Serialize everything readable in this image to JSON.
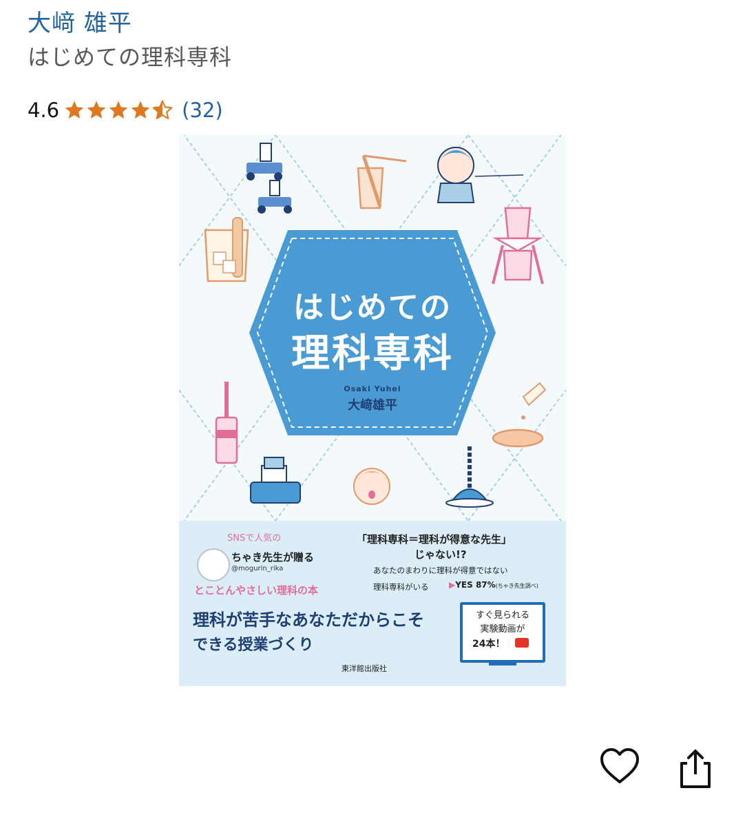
{
  "product": {
    "author": "大﨑 雄平",
    "title": "はじめての理科専科",
    "rating_value": "4.6",
    "rating_stars": 4.5,
    "rating_count": "(32)"
  },
  "cover": {
    "title_line1": "はじめての",
    "title_line2": "理科専科",
    "author_romaji": "Osaki  Yuhei",
    "author_name": "大﨑雄平",
    "sns_tagline": "SNSで人気の",
    "sns_person": "ちゃき先生が贈る",
    "sns_handle": "@mogurin_rika",
    "easy_book": "とことんやさしい理科の本",
    "quote_line1": "「理科専科＝理科が得意な先生」",
    "quote_line2": "じゃない!?",
    "survey_line1": "あなたのまわりに理科が得意ではない",
    "survey_line2": "理科専科がいる",
    "survey_yes": "YES",
    "survey_pct": "87%",
    "survey_note": "(ちゃき先生調べ)",
    "headline1": "理科が苦手なあなただからこそ",
    "headline2": "できる授業づくり",
    "video_line1": "すぐ見られる",
    "video_line2": "実験動画が",
    "video_line3": "24本！",
    "publisher": "東洋館出版社"
  },
  "colors": {
    "link": "#2162a1",
    "star": "#de7921",
    "hex_blue": "#4a9bd3",
    "lattice": "#a9cfe6",
    "pink": "#e26d96",
    "navy": "#1f3f73"
  },
  "icons": {
    "favorite": "heart-outline-icon",
    "share": "share-icon"
  }
}
